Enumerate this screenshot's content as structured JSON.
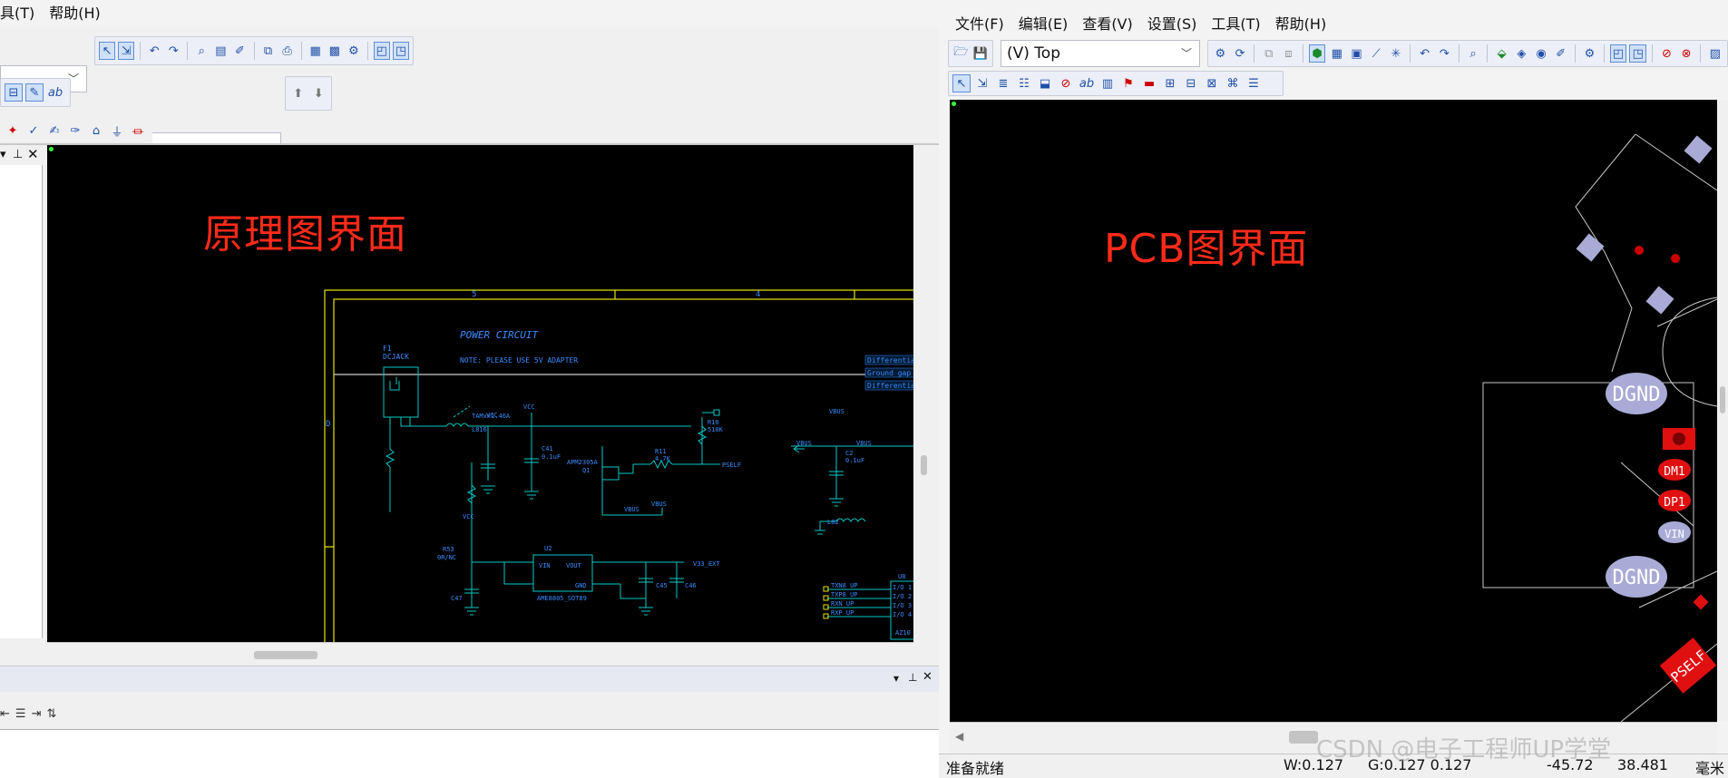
{
  "schematic_window": {
    "menus": [
      "具(T)",
      "帮助(H)"
    ],
    "canvas_title": "原理图界面",
    "panel_icons": [
      "pin-icon",
      "close-icon"
    ]
  },
  "pcb_window": {
    "menus": [
      "文件(F)",
      "编辑(E)",
      "查看(V)",
      "设置(S)",
      "工具(T)",
      "帮助(H)"
    ],
    "layer_select": "(V) Top",
    "canvas_title": "PCB图界面",
    "pads": [
      "DGND",
      "DM1",
      "DP1",
      "VIN",
      "DGND",
      "PSELF"
    ],
    "status": {
      "ready": "准备就绪",
      "width": "W:0.127",
      "grid": "G:0.127 0.127",
      "x": "-45.72",
      "y": "38.481",
      "unit": "毫米"
    }
  },
  "schematic_labels": {
    "power_circuit": "POWER CIRCUIT",
    "note": "NOTE: PLEASE USE 5V ADAPTER",
    "f1": "F1",
    "dcjack": "DCJACK",
    "fuse": "TAMxx1.46A",
    "l816": "L816",
    "vcc": "VCC",
    "c41": "C41",
    "c41v": "0.1uF",
    "apm": "APM2305A",
    "q1": "Q1",
    "r11": "R11",
    "r11v": "4.7K",
    "r10": "R10",
    "r10v": "510K",
    "pself": "PSELF",
    "vbus": "VBUS",
    "r53": "R53",
    "r53v": "0R/NC",
    "u2": "U2",
    "vin": "VIN",
    "vout": "VOUT",
    "gnd": "GND",
    "ame": "AME8805_SOT89",
    "v33": "V33_EXT",
    "c47": "C47",
    "c45": "C45",
    "c46": "C46",
    "diff1": "Differentia",
    "ground": "Ground gap",
    "diff2": "Differentia",
    "u8": "U8",
    "txn": "TXN8_UP",
    "txp": "TXP8_UP",
    "rxn": "RXN_UP",
    "rxp": "RXP_UP",
    "io1": "I/O 1",
    "io2": "I/O 2",
    "io3": "I/O 3",
    "io4": "I/O 4",
    "l82": "L82",
    "c2": "C2",
    "c2v": "0.1uF",
    "col5": "5",
    "col4": "4",
    "rowd": "D",
    "az": "AZ10"
  },
  "watermark": "CSDN @电子工程师UP学堂",
  "colors": {
    "canvas": "#000000",
    "wire": "#00c8c8",
    "border": "#e6e600",
    "label": "#3a8cff",
    "pad": "#a9abd6",
    "red_pad": "#e01010",
    "title_red": "#ff2a1a"
  }
}
